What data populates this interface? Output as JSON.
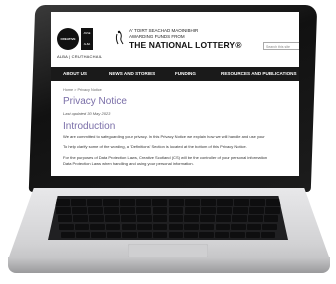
{
  "header": {
    "logo_circle_text": "CREATIVE",
    "logo_square_top": "ANSE",
    "logo_square_bottom": "ALBA",
    "logo_sub": "ALBA | CRUTHACHAIL",
    "lottery_line1": "A' TOIRT SEACHAD MAOINIBHIR",
    "lottery_line2": "AWARDING FUNDS FROM",
    "lottery_line3": "THE NATIONAL LOTTERY®",
    "search_placeholder": "Search this site"
  },
  "nav": {
    "items": [
      "ABOUT US",
      "NEWS AND STORIES",
      "FUNDING",
      "RESOURCES AND PUBLICATIONS"
    ]
  },
  "content": {
    "breadcrumb": "Home > Privacy Notice",
    "title": "Privacy Notice",
    "updated": "Last updated 30 May 2023",
    "intro_heading": "Introduction",
    "paragraphs": [
      "We are committed to safeguarding your privacy. In this Privacy Notice we explain how we will handle and use your",
      "To help clarify some of the wording, a 'Definitions' Section is located at the bottom of this Privacy Notice.",
      "For the purposes of Data Protection Laws, Creative Scotland (CS) will be the controller of your personal information",
      "Data Protection Laws when handling and using your personal information."
    ]
  }
}
